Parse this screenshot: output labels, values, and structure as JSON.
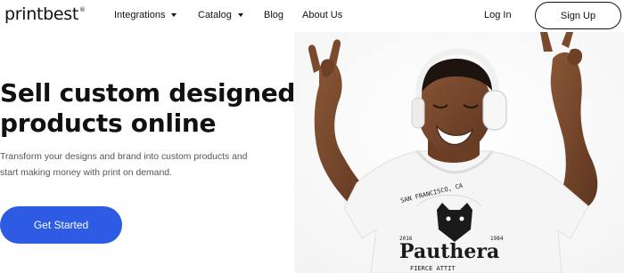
{
  "brand": {
    "name": "printbest",
    "mark": "®"
  },
  "nav": {
    "integrations": "Integrations",
    "catalog": "Catalog",
    "blog": "Blog",
    "about": "About Us",
    "login": "Log In",
    "signup": "Sign Up"
  },
  "hero": {
    "headline_line1": "Sell custom designed",
    "headline_line2": "products online",
    "subtext": "Transform your designs and brand into custom products and start making money with print on demand.",
    "cta": "Get Started"
  },
  "photo": {
    "shirt_text_top": "SAN FRANCISCO, CA",
    "shirt_year_left": "2016",
    "shirt_year_right": "1984",
    "shirt_brand": "Pauthera",
    "shirt_tagline": "FIERCE ATTIT"
  },
  "colors": {
    "accent": "#2d5be3",
    "text": "#111111",
    "muted": "#555555"
  }
}
